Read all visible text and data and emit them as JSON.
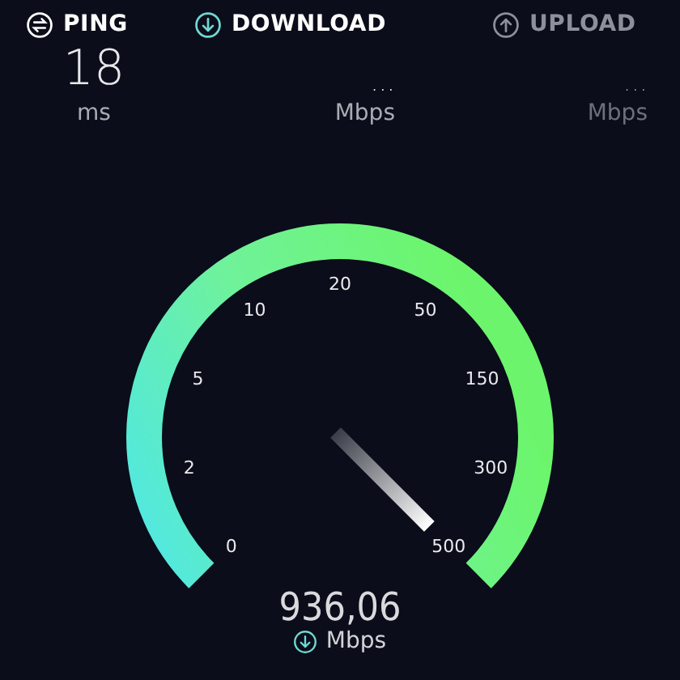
{
  "metrics": [
    {
      "kind": "ping",
      "label": "PING",
      "value": "18",
      "unit": "ms",
      "dimmed": false
    },
    {
      "kind": "download",
      "label": "DOWNLOAD",
      "value": "...",
      "unit": "Mbps",
      "dimmed": false
    },
    {
      "kind": "upload",
      "label": "UPLOAD",
      "value": "...",
      "unit": "Mbps",
      "dimmed": true
    }
  ],
  "gauge": {
    "scale": [
      "0",
      "2",
      "5",
      "10",
      "20",
      "50",
      "150",
      "300",
      "500"
    ],
    "reading": "936,06",
    "unit": "Mbps"
  }
}
